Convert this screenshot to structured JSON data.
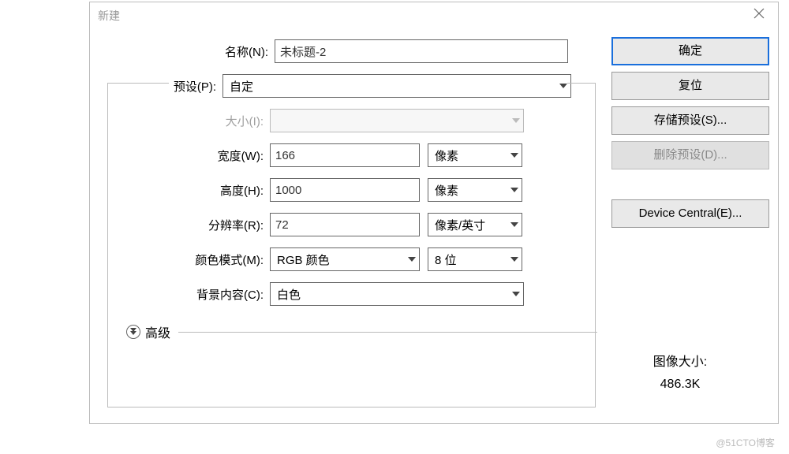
{
  "dialog": {
    "title": "新建"
  },
  "fields": {
    "name_label": "名称(N):",
    "name_value": "未标题-2",
    "preset_label": "预设(P):",
    "preset_value": "自定",
    "size_label": "大小(I):",
    "width_label": "宽度(W):",
    "width_value": "166",
    "width_unit": "像素",
    "height_label": "高度(H):",
    "height_value": "1000",
    "height_unit": "像素",
    "resolution_label": "分辨率(R):",
    "resolution_value": "72",
    "resolution_unit": "像素/英寸",
    "color_mode_label": "颜色模式(M):",
    "color_mode_value": "RGB 颜色",
    "color_depth_value": "8 位",
    "background_label": "背景内容(C):",
    "background_value": "白色",
    "advanced_label": "高级"
  },
  "buttons": {
    "ok": "确定",
    "reset": "复位",
    "save_preset": "存储预设(S)...",
    "delete_preset": "删除预设(D)...",
    "device_central": "Device Central(E)..."
  },
  "info": {
    "image_size_label": "图像大小:",
    "image_size_value": "486.3K"
  },
  "watermark": "@51CTO博客"
}
